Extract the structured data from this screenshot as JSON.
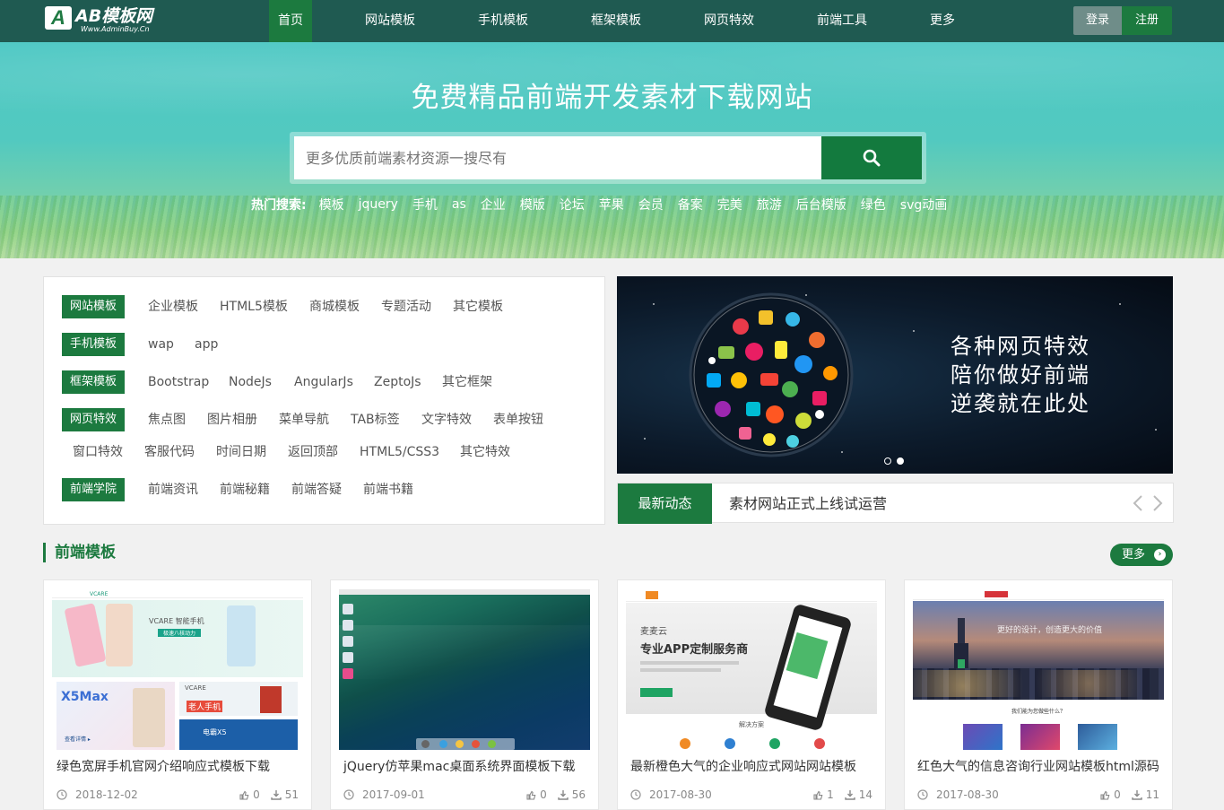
{
  "brand": {
    "logo_mark": "A",
    "name": "AB模板网",
    "sub": "Www.AdminBuy.Cn"
  },
  "nav": {
    "items": [
      "首页",
      "网站模板",
      "手机模板",
      "框架模板",
      "网页特效",
      "前端工具",
      "更多"
    ],
    "login": "登录",
    "register": "注册"
  },
  "banner": {
    "title": "免费精品前端开发素材下载网站",
    "search_placeholder": "更多优质前端素材资源一搜尽有",
    "hot_label": "热门搜索:",
    "hot_keywords": [
      "模板",
      "jquery",
      "手机",
      "as",
      "企业",
      "模版",
      "论坛",
      "苹果",
      "会员",
      "备案",
      "完美",
      "旅游",
      "后台模版",
      "绿色",
      "svg动画"
    ]
  },
  "categories": {
    "website": {
      "tag": "网站模板",
      "links": [
        "企业模板",
        "HTML5模板",
        "商城模板",
        "专题活动",
        "其它模板"
      ]
    },
    "mobile": {
      "tag": "手机模板",
      "links": [
        "wap",
        "app"
      ]
    },
    "framework": {
      "tag": "框架模板",
      "links": [
        "Bootstrap",
        "NodeJs",
        "AngularJs",
        "ZeptoJs",
        "其它框架"
      ]
    },
    "effects": {
      "tag": "网页特效",
      "links": [
        "焦点图",
        "图片相册",
        "菜单导航",
        "TAB标签",
        "文字特效",
        "表单按钮",
        "窗口特效",
        "客服代码",
        "时间日期",
        "返回顶部",
        "HTML5/CSS3",
        "其它特效"
      ]
    },
    "academy": {
      "tag": "前端学院",
      "links": [
        "前端资讯",
        "前端秘籍",
        "前端答疑",
        "前端书籍"
      ]
    }
  },
  "slider": {
    "lines": [
      "各种网页特效",
      "陪你做好前端",
      "逆袭就在此处"
    ],
    "active_index": 1,
    "count": 2
  },
  "news": {
    "tag": "最新动态",
    "text": "素材网站正式上线试运营"
  },
  "section": {
    "title": "前端模板",
    "more": "更多"
  },
  "cards": [
    {
      "title": "绿色宽屏手机官网介绍响应式模板下载",
      "date": "2018-12-02",
      "likes": "0",
      "downloads": "51"
    },
    {
      "title": "jQuery仿苹果mac桌面系统界面模板下载",
      "date": "2017-09-01",
      "likes": "0",
      "downloads": "56"
    },
    {
      "title": "最新橙色大气的企业响应式网站网站模板",
      "date": "2017-08-30",
      "likes": "1",
      "downloads": "14"
    },
    {
      "title": "红色大气的信息咨询行业网站模板html源码",
      "date": "2017-08-30",
      "likes": "0",
      "downloads": "11"
    }
  ],
  "thumbs": {
    "c1": {
      "brand": "VCARE",
      "headline": "VCARE 智能手机",
      "sub": "极速八核动力",
      "product": "X5Max",
      "promo": "老人手机",
      "model": "电霸X5",
      "link": "查看详情 ▸"
    },
    "c3": {
      "brand": "麦麦云",
      "headline": "专业APP定制服务商",
      "section": "解决方案"
    },
    "c4": {
      "slogan": "更好的设计，创造更大的价值",
      "section": "我们能为您做些什么？"
    }
  },
  "colors": {
    "primary": "#1c7a3f",
    "nav_bg": "#1f5a51",
    "login_bg": "#6f8d89",
    "page_bg": "#f1f1f1"
  }
}
